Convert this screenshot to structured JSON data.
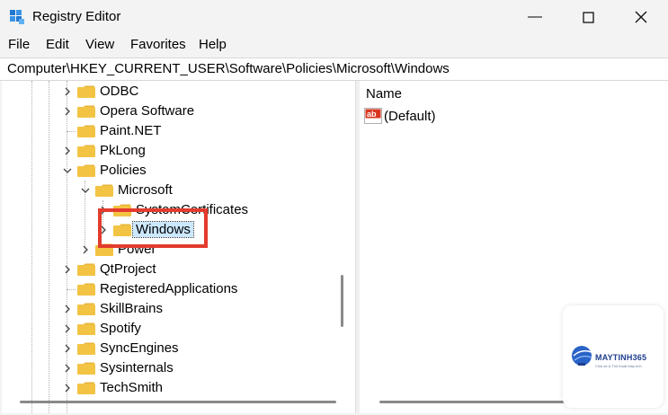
{
  "window": {
    "title": "Registry Editor"
  },
  "menu": [
    "File",
    "Edit",
    "View",
    "Favorites",
    "Help"
  ],
  "address": "Computer\\HKEY_CURRENT_USER\\Software\\Policies\\Microsoft\\Windows",
  "tree": [
    {
      "label": "ODBC",
      "state": "collapsed"
    },
    {
      "label": "Opera Software",
      "state": "collapsed"
    },
    {
      "label": "Paint.NET",
      "state": "leaf"
    },
    {
      "label": "PkLong",
      "state": "collapsed"
    },
    {
      "label": "Policies",
      "state": "expanded"
    },
    {
      "label": "Microsoft",
      "state": "expanded"
    },
    {
      "label": "SystemCertificates",
      "state": "collapsed"
    },
    {
      "label": "Windows",
      "state": "collapsed",
      "selected": true
    },
    {
      "label": "Power",
      "state": "collapsed"
    },
    {
      "label": "QtProject",
      "state": "collapsed"
    },
    {
      "label": "RegisteredApplications",
      "state": "leaf"
    },
    {
      "label": "SkillBrains",
      "state": "collapsed"
    },
    {
      "label": "Spotify",
      "state": "collapsed"
    },
    {
      "label": "SyncEngines",
      "state": "collapsed"
    },
    {
      "label": "Sysinternals",
      "state": "collapsed"
    },
    {
      "label": "TechSmith",
      "state": "collapsed"
    }
  ],
  "list": {
    "columns": [
      "Name"
    ],
    "rows": [
      {
        "name": "(Default)",
        "icon": "string-value-icon"
      }
    ]
  },
  "watermark": {
    "name": "MAYTINH365",
    "tagline": "Chia sẻ & Thủ thuật Máy tính"
  },
  "colors": {
    "accent": "#cce8ff",
    "highlight": "#e33b2e",
    "folder": "#f3c444"
  }
}
